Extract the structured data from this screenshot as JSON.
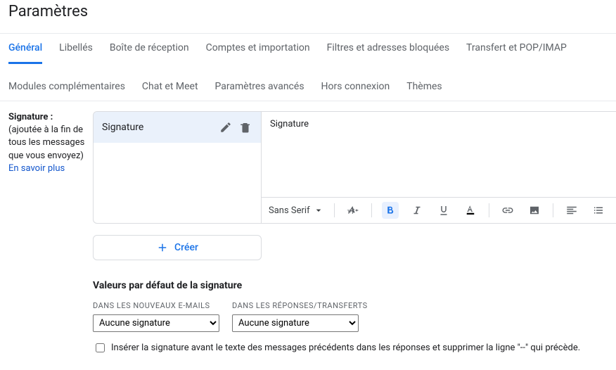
{
  "title": "Paramètres",
  "tabs": {
    "general": "Général",
    "labels": "Libellés",
    "inbox": "Boîte de réception",
    "accounts": "Comptes et importation",
    "filters": "Filtres et adresses bloquées",
    "forwarding": "Transfert et POP/IMAP",
    "addons": "Modules complémentaires",
    "chat": "Chat et Meet",
    "advanced": "Paramètres avancés",
    "offline": "Hors connexion",
    "themes": "Thèmes"
  },
  "signature": {
    "label": "Signature :",
    "desc": "(ajoutée à la fin de tous les messages que vous envoyez)",
    "learn_more": "En savoir plus",
    "item_name": "Signature",
    "body": "Signature",
    "font": "Sans Serif",
    "create": "Créer",
    "defaults_title": "Valeurs par défaut de la signature",
    "new_label": "DANS LES NOUVEAUX E-MAILS",
    "reply_label": "DANS LES RÉPONSES/TRANSFERTS",
    "option_none": "Aucune signature",
    "insert_before": "Insérer la signature avant le texte des messages précédents dans les réponses et supprimer la ligne \"--\" qui précède."
  }
}
